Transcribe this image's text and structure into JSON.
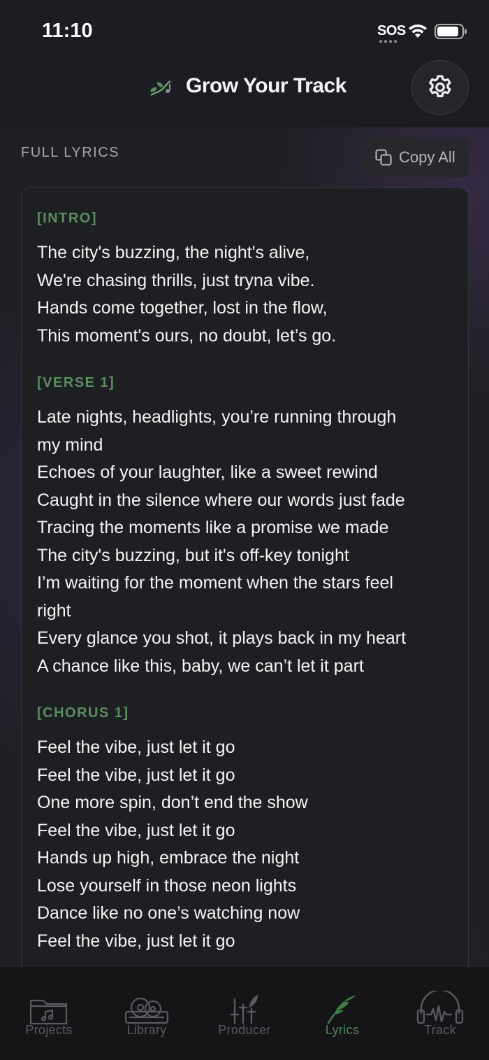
{
  "status_bar": {
    "time": "11:10",
    "sos": "SOS"
  },
  "header": {
    "title": "Grow Your Track",
    "logo_icon": "plant-note-logo",
    "settings_icon": "gear-icon"
  },
  "lyrics_section": {
    "label": "FULL LYRICS",
    "copy_button_label": "Copy All",
    "copy_icon": "copy-icon"
  },
  "lyrics": [
    {
      "tag": "[INTRO]",
      "lines": [
        "The city's buzzing, the night's alive,",
        "We're chasing thrills, just tryna vibe.",
        "Hands come together, lost in the flow,",
        "This moment's ours, no doubt, let’s go."
      ]
    },
    {
      "tag": "[VERSE 1]",
      "lines": [
        "Late nights, headlights, you’re running through",
        "my mind",
        "Echoes of your laughter, like a sweet rewind",
        "Caught in the silence where our words just fade",
        "Tracing the moments like a promise we made",
        "The city's buzzing, but it's off-key tonight",
        "I’m waiting for the moment when the stars feel",
        "right",
        "Every glance you shot, it plays back in my heart",
        "A chance like this, baby, we can’t let it part"
      ]
    },
    {
      "tag": "[CHORUS 1]",
      "lines": [
        "Feel the vibe, just let it go",
        "Feel the vibe, just let it go",
        "One more spin, don’t end the show",
        "Feel the vibe, just let it go",
        "Hands up high, embrace the night",
        "Lose yourself in those neon lights",
        "Dance like no one’s watching now",
        "Feel the vibe, just let it go"
      ]
    }
  ],
  "tab_bar": {
    "tabs": [
      {
        "label": "Projects",
        "icon": "folder-music-icon",
        "active": false
      },
      {
        "label": "Library",
        "icon": "vinyl-library-icon",
        "active": false
      },
      {
        "label": "Producer",
        "icon": "mixer-sliders-icon",
        "active": false
      },
      {
        "label": "Lyrics",
        "icon": "quill-icon",
        "active": true
      },
      {
        "label": "Track",
        "icon": "headphones-waveform-icon",
        "active": false
      }
    ]
  },
  "colors": {
    "accent_green": "#4e8753",
    "tag_green": "#5b8d5e",
    "background": "#1f2025"
  }
}
